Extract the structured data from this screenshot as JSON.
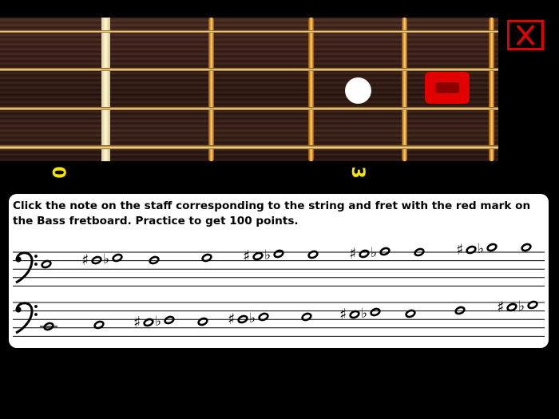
{
  "fretboard": {
    "fret_numbers": [
      "0",
      "3"
    ],
    "strings": 4,
    "colors": {
      "wood": "#3a1f18",
      "fret": "#f5a623",
      "nut": "#f3e9b8",
      "mark": "#e30000",
      "fret_number": "#f4e600"
    },
    "inlay": "dot-inlay",
    "red_mark": "target-mark"
  },
  "close_button": {
    "icon": "close-icon",
    "color": "#e30000"
  },
  "instruction": "Click the note on the staff corresponding to the string and fret with the red mark on the Bass fretboard. Practice to get 100 points.",
  "staff": {
    "clef": "bass-clef",
    "accidentals": {
      "sharp": "♯",
      "flat": "♭"
    },
    "rows": [
      {
        "name": "upper-staff",
        "notes": [
          {
            "acc": "",
            "kind": "natural"
          },
          {
            "acc": "♯♭",
            "kind": "enharmonic"
          },
          {
            "acc": "",
            "kind": "natural"
          },
          {
            "acc": "",
            "kind": "natural"
          },
          {
            "acc": "♯♭",
            "kind": "enharmonic"
          },
          {
            "acc": "",
            "kind": "natural"
          },
          {
            "acc": "♯♭",
            "kind": "enharmonic"
          },
          {
            "acc": "",
            "kind": "natural"
          },
          {
            "acc": "♯♭",
            "kind": "enharmonic"
          },
          {
            "acc": "",
            "kind": "natural"
          }
        ]
      },
      {
        "name": "lower-staff",
        "notes": [
          {
            "acc": "",
            "kind": "natural"
          },
          {
            "acc": "",
            "kind": "natural"
          },
          {
            "acc": "♯♭",
            "kind": "enharmonic"
          },
          {
            "acc": "",
            "kind": "natural"
          },
          {
            "acc": "♯♭",
            "kind": "enharmonic"
          },
          {
            "acc": "",
            "kind": "natural"
          },
          {
            "acc": "♯♭",
            "kind": "enharmonic"
          },
          {
            "acc": "",
            "kind": "natural"
          },
          {
            "acc": "",
            "kind": "natural"
          },
          {
            "acc": "♯♭",
            "kind": "enharmonic"
          }
        ]
      }
    ]
  }
}
